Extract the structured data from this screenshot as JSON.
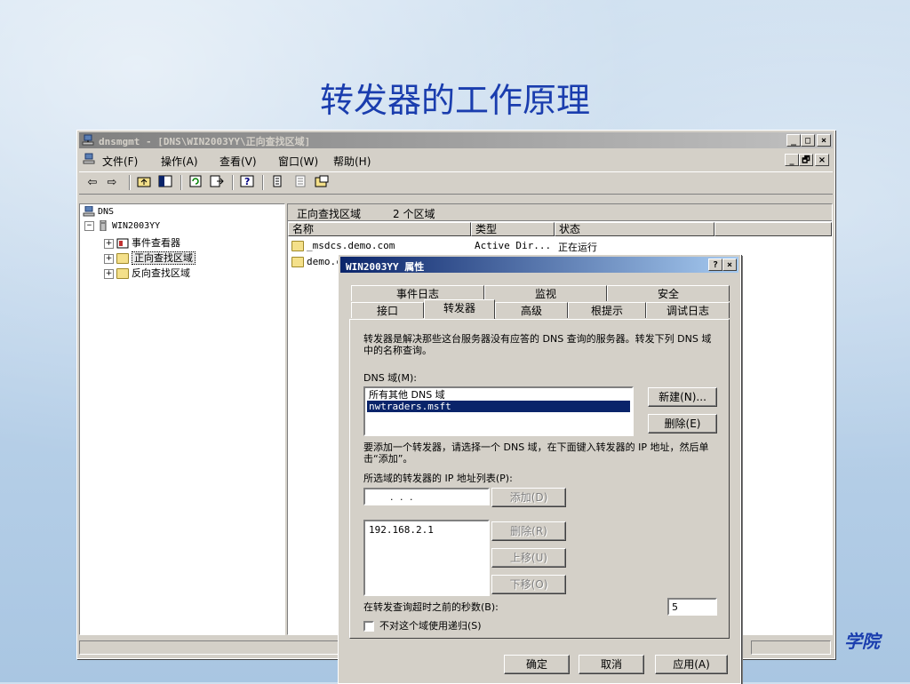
{
  "slide": {
    "title": "转发器的工作原理",
    "footer_brand": "学院"
  },
  "window": {
    "title": "dnsmgmt - [DNS\\WIN2003YY\\正向查找区域]",
    "caption_buttons": [
      "_",
      "□",
      "×"
    ],
    "mdi_buttons": [
      "_",
      "🗗",
      "×"
    ]
  },
  "menu": {
    "items": [
      "文件(F)",
      "操作(A)",
      "查看(V)",
      "窗口(W)",
      "帮助(H)"
    ]
  },
  "toolbar": {
    "icons": [
      "back-arrow-icon",
      "forward-arrow-icon",
      "up-folder-icon",
      "show-tree-icon",
      "refresh-icon",
      "export-icon",
      "help-icon",
      "list-icon",
      "properties-icon",
      "zone-icon"
    ]
  },
  "tree": {
    "root": "DNS",
    "server": "WIN2003YY",
    "items": [
      "事件查看器",
      "正向查找区域",
      "反向查找区域"
    ]
  },
  "pane": {
    "header_title": "正向查找区域",
    "header_count": "2 个区域",
    "columns": [
      "名称",
      "类型",
      "状态"
    ],
    "rows": [
      {
        "name": "_msdcs.demo.com",
        "type": "Active Dir...",
        "status": "正在运行"
      },
      {
        "name": "demo.c",
        "type": "",
        "status": ""
      }
    ]
  },
  "dialog": {
    "title": "WIN2003YY 属性",
    "help_button": "?",
    "close_button": "×",
    "tabs_back": [
      "事件日志",
      "监视",
      "安全"
    ],
    "tabs_front": [
      "接口",
      "转发器",
      "高级",
      "根提示",
      "调试日志"
    ],
    "active_tab": "转发器",
    "description": "转发器是解决那些这台服务器没有应答的 DNS 查询的服务器。转发下列 DNS 域中的名称查询。",
    "dns_domain_label": "DNS 域(M):",
    "dns_domains": [
      "所有其他 DNS 域",
      "nwtraders.msft"
    ],
    "selected_domain": "nwtraders.msft",
    "new_button": "新建(N)...",
    "delete_button": "删除(E)",
    "add_hint": "要添加一个转发器，请选择一个 DNS 域，在下面键入转发器的 IP 地址，然后单击“添加”。",
    "ip_list_label": "所选域的转发器的 IP 地址列表(P):",
    "ip_input_placeholder": ".    .    .",
    "add_button": "添加(D)",
    "ip_list": [
      "192.168.2.1"
    ],
    "remove_button": "删除(R)",
    "move_up_button": "上移(U)",
    "move_down_button": "下移(O)",
    "timeout_label": "在转发查询超时之前的秒数(B):",
    "timeout_value": "5",
    "no_recursion_label": "不对这个域使用递归(S)",
    "ok_button": "确定",
    "cancel_button": "取消",
    "apply_button": "应用(A)"
  }
}
